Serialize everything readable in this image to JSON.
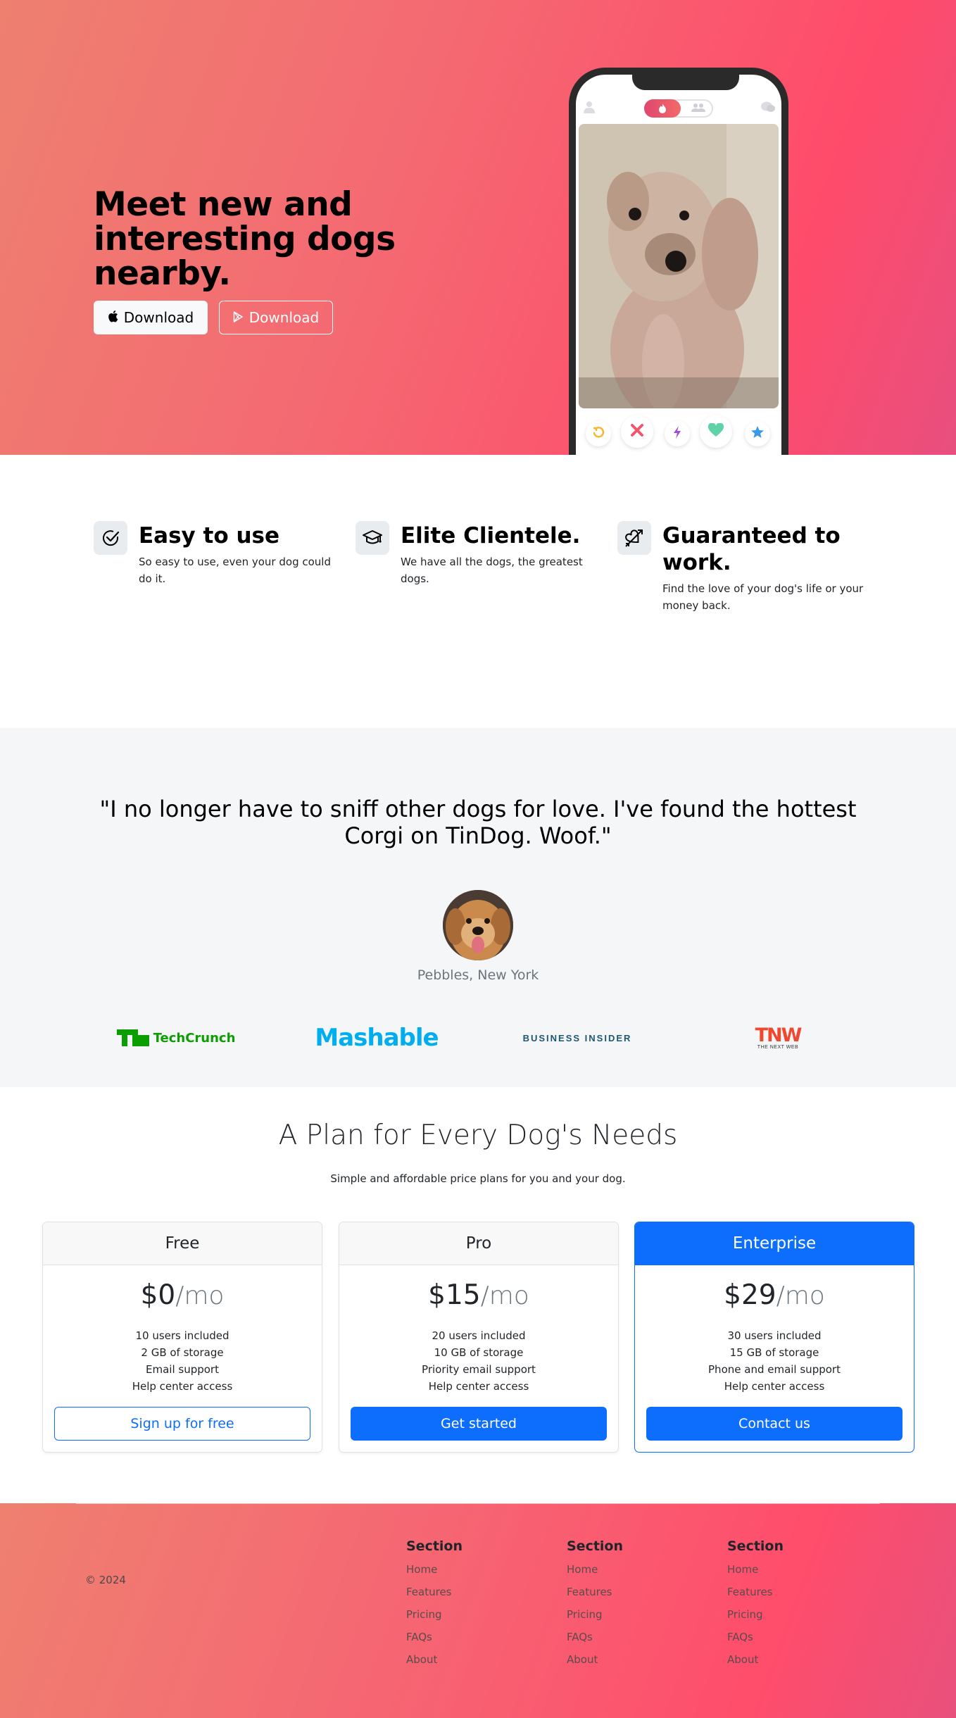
{
  "hero": {
    "title": "Meet new and interesting dogs nearby.",
    "apple_download_label": "Download",
    "play_download_label": "Download"
  },
  "features": [
    {
      "title": "Easy to use",
      "text": "So easy to use, even your dog could do it.",
      "icon": "check-circle-icon"
    },
    {
      "title": "Elite Clientele.",
      "text": "We have all the dogs, the greatest dogs.",
      "icon": "graduation-cap-icon"
    },
    {
      "title": "Guaranteed to work.",
      "text": "Find the love of your dog's life or your money back.",
      "icon": "heart-arrow-icon"
    }
  ],
  "testimonial": {
    "quote": "\"I no longer have to sniff other dogs for love. I've found the hottest Corgi on TinDog. Woof.\"",
    "author": "Pebbles, New York"
  },
  "press": {
    "techcrunch_1": "TechCrunch",
    "mashable": "Mashable",
    "business_insider": "BUSINESS INSIDER",
    "tnw": "TNW",
    "tnw_sub": "THE NEXT WEB"
  },
  "pricing": {
    "title": "A Plan for Every Dog's Needs",
    "subtitle": "Simple and affordable price plans for you and your dog.",
    "per_label": "/mo",
    "plans": [
      {
        "name": "Free",
        "price": "$0",
        "features": [
          "10 users included",
          "2 GB of storage",
          "Email support",
          "Help center access"
        ],
        "cta": "Sign up for free"
      },
      {
        "name": "Pro",
        "price": "$15",
        "features": [
          "20 users included",
          "10 GB of storage",
          "Priority email support",
          "Help center access"
        ],
        "cta": "Get started"
      },
      {
        "name": "Enterprise",
        "price": "$29",
        "features": [
          "30 users included",
          "15 GB of storage",
          "Phone and email support",
          "Help center access"
        ],
        "cta": "Contact us"
      }
    ]
  },
  "footer": {
    "copyright": "© 2024",
    "columns": [
      {
        "heading": "Section",
        "links": [
          "Home",
          "Features",
          "Pricing",
          "FAQs",
          "About"
        ]
      },
      {
        "heading": "Section",
        "links": [
          "Home",
          "Features",
          "Pricing",
          "FAQs",
          "About"
        ]
      },
      {
        "heading": "Section",
        "links": [
          "Home",
          "Features",
          "Pricing",
          "FAQs",
          "About"
        ]
      }
    ]
  },
  "colors": {
    "hero_gradient_start": "#ee8070",
    "hero_gradient_end": "#ff4b6b",
    "primary_blue": "#0d6efd",
    "testimonial_bg": "#f5f6f8"
  }
}
